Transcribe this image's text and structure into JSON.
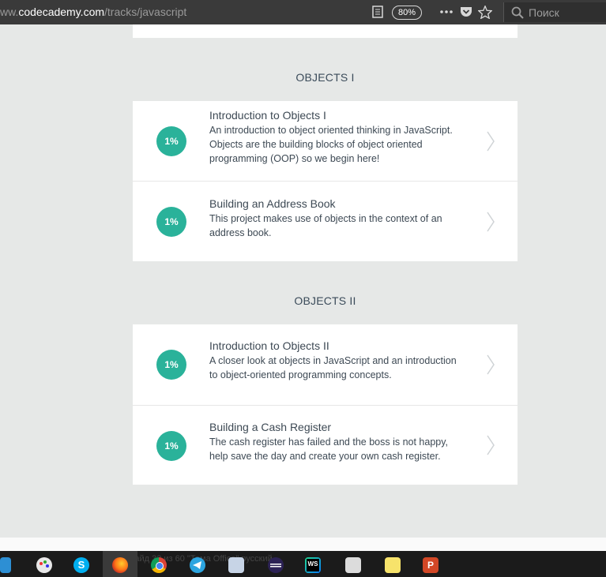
{
  "browser": {
    "url_prefix": "ww.",
    "url_host": "codecademy.com",
    "url_path": "/tracks/javascript",
    "zoom": "80%",
    "search_placeholder": "Поиск",
    "reader_icon": "reader-icon",
    "more_icon": "more-icon",
    "pocket_icon": "pocket-icon",
    "bookmark_icon": "star-icon",
    "search_icon": "search-icon"
  },
  "sections": [
    {
      "title": "OBJECTS I",
      "lessons": [
        {
          "progress": "1%",
          "title": "Introduction to Objects I",
          "description": "An introduction to object oriented thinking in JavaScript. Objects are the building blocks of object oriented programming (OOP) so we begin here!"
        },
        {
          "progress": "1%",
          "title": "Building an Address Book",
          "description": "This project makes use of objects in the context of an address book."
        }
      ]
    },
    {
      "title": "OBJECTS II",
      "lessons": [
        {
          "progress": "1%",
          "title": "Introduction to Objects II",
          "description": "A closer look at objects in JavaScript and an introduction to object-oriented programming concepts."
        },
        {
          "progress": "1%",
          "title": "Building a Cash Register",
          "description": "The cash register has failed and the boss is not happy, help save the day and create your own cash register."
        }
      ]
    }
  ],
  "colors": {
    "accent": "#2ab29a",
    "background": "#e6e8e7",
    "text": "#3d4954"
  },
  "taskbar": {
    "ghost_text": "Слайд 33 из 60   \"Тема Office\"   русский",
    "apps": [
      "window-icon",
      "paint-icon",
      "skype-icon",
      "firefox-icon",
      "chrome-icon",
      "telegram-icon",
      "image-viewer-icon",
      "eclipse-icon",
      "webstorm-icon",
      "screenshot-icon",
      "sticky-notes-icon",
      "powerpoint-icon"
    ]
  }
}
